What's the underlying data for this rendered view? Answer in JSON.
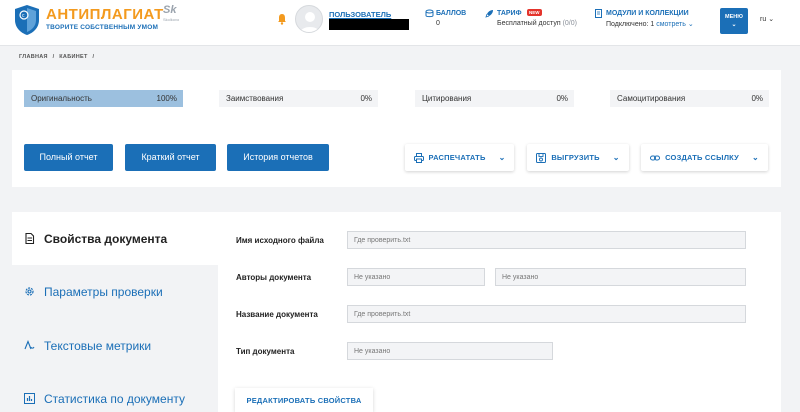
{
  "header": {
    "logo_title_a": "АНТИПЛАГИАТ",
    "logo_subtitle": "ТВОРИТЕ СОБСТВЕННЫМ УМОМ",
    "partner_logo": "Sk",
    "partner_sub": "Skolkovo",
    "user": {
      "label": "ПОЛЬЗОВАТЕЛЬ"
    },
    "balance": {
      "label": "БАЛЛОВ",
      "value": "0"
    },
    "tariff": {
      "label": "ТАРИФ",
      "badge": "NEW",
      "value": "Бесплатный доступ",
      "count": "(0/0)"
    },
    "modules": {
      "label": "МОДУЛИ И КОЛЛЕКЦИИ",
      "value": "Подключено: 1",
      "link": "смотреть"
    },
    "menu_label": "МЕНЮ",
    "language": "ru"
  },
  "breadcrumb": [
    "ГЛАВНАЯ",
    "/",
    "КАБИНЕТ",
    "/"
  ],
  "metrics": [
    {
      "name": "Оригинальность",
      "value": "100%",
      "fill": 1.0
    },
    {
      "name": "Заимствования",
      "value": "0%",
      "fill": 0
    },
    {
      "name": "Цитирования",
      "value": "0%",
      "fill": 0
    },
    {
      "name": "Самоцитирования",
      "value": "0%",
      "fill": 0
    }
  ],
  "buttons": {
    "full_report": "Полный отчет",
    "short_report": "Краткий отчет",
    "history": "История отчетов",
    "print": "РАСПЕЧАТАТЬ",
    "export": "ВЫГРУЗИТЬ",
    "create_link": "СОЗДАТЬ ССЫЛКУ"
  },
  "nav": [
    {
      "label": "Свойства документа",
      "icon": "document-icon",
      "active": true
    },
    {
      "label": "Параметры проверки",
      "icon": "gear-icon",
      "active": false
    },
    {
      "label": "Текстовые метрики",
      "icon": "text-metrics-icon",
      "active": false
    },
    {
      "label": "Статистика по документу",
      "icon": "bar-chart-icon",
      "active": false
    }
  ],
  "properties": {
    "source_file": {
      "label": "Имя исходного файла",
      "value": "Где проверить.txt"
    },
    "authors": {
      "label": "Авторы документа",
      "value1": "Не указано",
      "value2": "Не указано"
    },
    "title": {
      "label": "Название документа",
      "value": "Где проверить.txt"
    },
    "type": {
      "label": "Тип документа",
      "value": "Не указано"
    }
  },
  "edit_button": "РЕДАКТИРОВАТЬ СВОЙСТВА",
  "colors": {
    "brand_blue": "#1b6fb7",
    "brand_orange": "#f39a1e",
    "originality_fill": "#9cc0df"
  }
}
